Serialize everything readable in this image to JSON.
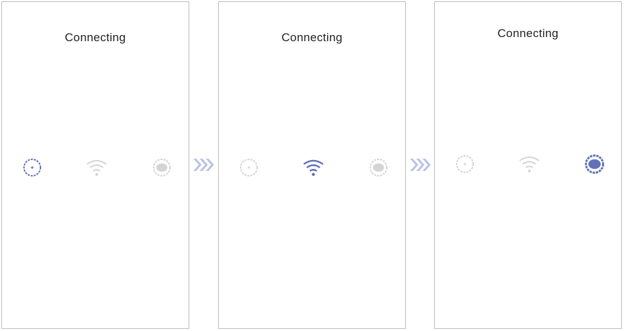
{
  "colors": {
    "active": "#5f73b6",
    "inactive": "#d4d4d4",
    "chevron": "#b8c1e3",
    "border": "#bdbdbd"
  },
  "screens": [
    {
      "title": "Connecting",
      "description": "",
      "icons": [
        {
          "name": "phone-icon",
          "state": "active"
        },
        {
          "name": "wifi-icon",
          "state": "inactive"
        },
        {
          "name": "device-icon",
          "state": "inactive"
        }
      ]
    },
    {
      "title": "Connecting",
      "description": "",
      "icons": [
        {
          "name": "phone-icon",
          "state": "inactive"
        },
        {
          "name": "wifi-icon",
          "state": "active"
        },
        {
          "name": "device-icon",
          "state": "inactive"
        }
      ]
    },
    {
      "title": "Connecting",
      "description": "",
      "icons": [
        {
          "name": "phone-icon",
          "state": "inactive"
        },
        {
          "name": "wifi-icon",
          "state": "inactive"
        },
        {
          "name": "device-icon",
          "state": "active"
        }
      ]
    }
  ],
  "arrows": [
    {
      "name": "chevron-right-icon"
    },
    {
      "name": "chevron-right-icon"
    }
  ]
}
